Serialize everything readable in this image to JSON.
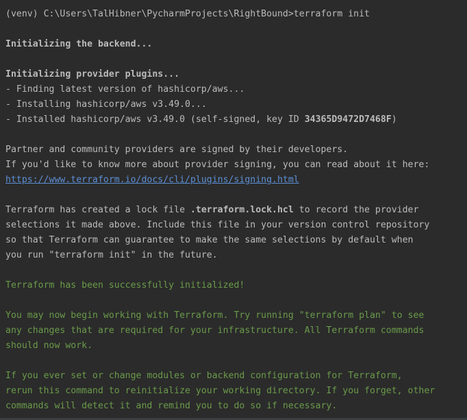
{
  "terminal": {
    "prompt": "(venv) C:\\Users\\TalHibner\\PycharmProjects\\RightBound>",
    "command": "terraform init",
    "backend_init": "Initializing the backend...",
    "provider_init": "Initializing provider plugins...",
    "finding": "- Finding latest version of hashicorp/aws...",
    "installing": "- Installing hashicorp/aws v3.49.0...",
    "installed_prefix": "- Installed hashicorp/aws v3.49.0 (self-signed, key ID ",
    "key_id": "34365D9472D7468F",
    "installed_suffix": ")",
    "partner_line1": "Partner and community providers are signed by their developers.",
    "partner_line2": "If you'd like to know more about provider signing, you can read about it here:",
    "signing_url": "https://www.terraform.io/docs/cli/plugins/signing.html",
    "lock_prefix": "Terraform has created a lock file ",
    "lock_file": ".terraform.lock.hcl",
    "lock_suffix": " to record the provider",
    "lock_line2": "selections it made above. Include this file in your version control repository",
    "lock_line3": "so that Terraform can guarantee to make the same selections by default when",
    "lock_line4": "you run \"terraform init\" in the future.",
    "success": "Terraform has been successfully initialized!",
    "begin_line1": "You may now begin working with Terraform. Try running \"terraform plan\" to see",
    "begin_line2": "any changes that are required for your infrastructure. All Terraform commands",
    "begin_line3": "should now work.",
    "modules_line1": "If you ever set or change modules or backend configuration for Terraform,",
    "modules_line2": "rerun this command to reinitialize your working directory. If you forget, other",
    "modules_line3": "commands will detect it and remind you to do so if necessary."
  },
  "colors": {
    "background": "#2b2b2b",
    "text": "#bbbbbb",
    "success_green": "#6a9a4a",
    "link_blue": "#5c8fd6"
  }
}
